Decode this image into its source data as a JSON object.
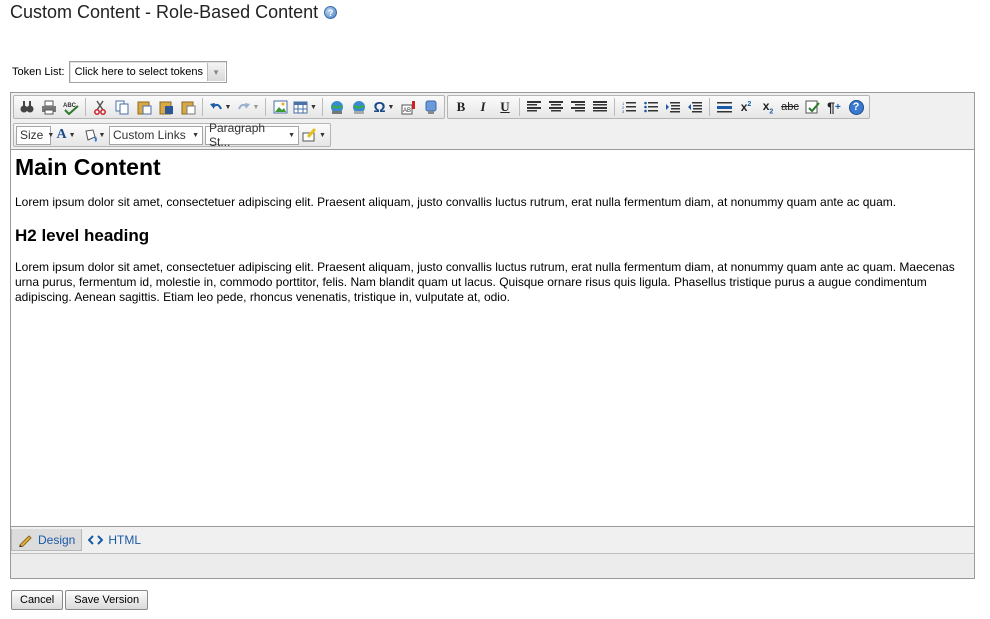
{
  "page": {
    "title": "Custom Content - Role-Based Content",
    "help_icon": "help-icon"
  },
  "token": {
    "label": "Token List:",
    "select_value": "Click here to select tokens"
  },
  "toolbar": {
    "size_label": "Size",
    "custom_links_label": "Custom Links",
    "paragraph_label": "Paragraph St..."
  },
  "content": {
    "heading1": "Main Content",
    "para1": "Lorem ipsum dolor sit amet, consectetuer adipiscing elit. Praesent aliquam, justo convallis luctus rutrum, erat nulla fermentum diam, at nonummy quam ante ac quam.",
    "heading2": "H2 level heading",
    "para2": "Lorem ipsum dolor sit amet, consectetuer adipiscing elit. Praesent aliquam, justo convallis luctus rutrum, erat nulla fermentum diam, at nonummy quam ante ac quam. Maecenas urna purus, fermentum id, molestie in, commodo porttitor, felis. Nam blandit quam ut lacus. Quisque ornare risus quis ligula. Phasellus tristique purus a augue condimentum adipiscing. Aenean sagittis. Etiam leo pede, rhoncus venenatis, tristique in, vulputate at, odio."
  },
  "modes": {
    "design": "Design",
    "html": "HTML"
  },
  "buttons": {
    "cancel": "Cancel",
    "save_version": "Save Version"
  },
  "colors": {
    "link_blue": "#1a5aa8",
    "spell_red": "#d00000"
  }
}
